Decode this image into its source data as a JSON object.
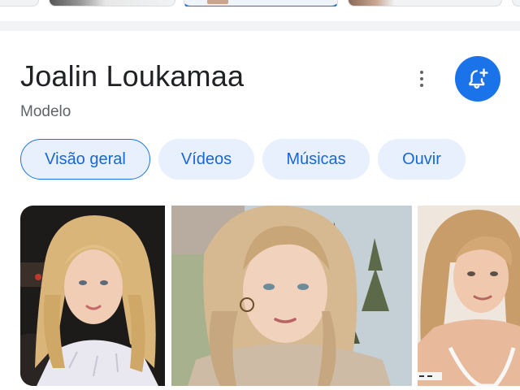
{
  "entity": {
    "name": "Joalin Loukamaa",
    "category": "Modelo"
  },
  "actions": {
    "more_icon": "more-vert-icon",
    "follow_icon": "bell-plus-icon"
  },
  "tabs": [
    {
      "label": "Visão geral",
      "selected": true
    },
    {
      "label": "Vídeos",
      "selected": false
    },
    {
      "label": "Músicas",
      "selected": false
    },
    {
      "label": "Ouvir",
      "selected": false
    }
  ],
  "colors": {
    "accent": "#1a73e8",
    "chip_background": "#e8f0fe",
    "chip_text": "#1967d2",
    "title_text": "#202124",
    "secondary_text": "#5f6368"
  }
}
